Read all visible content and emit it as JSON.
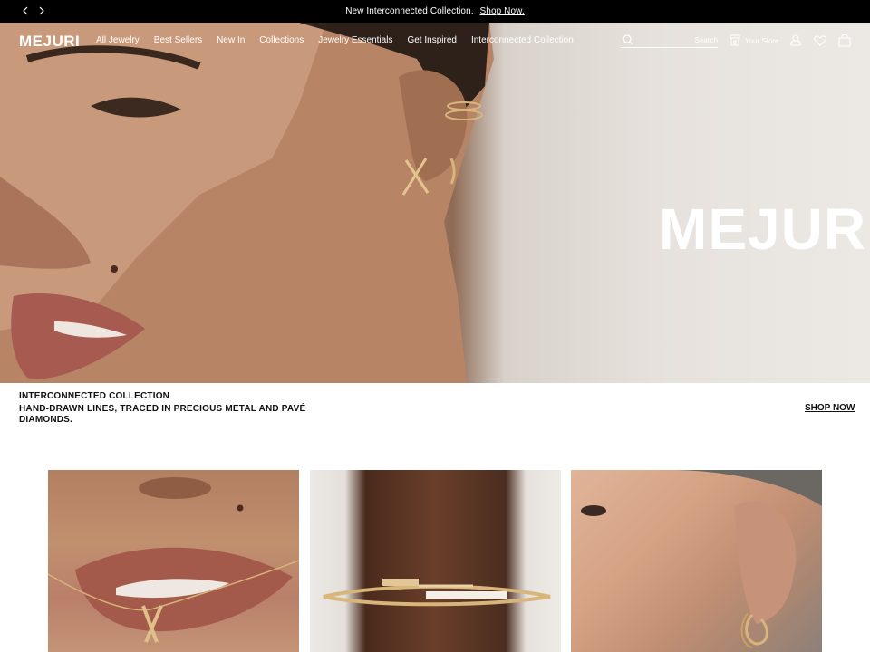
{
  "announcement": {
    "message": "New Interconnected Collection.",
    "link": "Shop Now."
  },
  "header": {
    "logo": "MEJURI",
    "menu": [
      "All Jewelry",
      "Best Sellers",
      "New In",
      "Collections",
      "Jewelry Essentials",
      "Get Inspired",
      "Interconnected Collection"
    ],
    "search_label": "Search",
    "store_label": "Your Store",
    "icons": [
      "search-icon",
      "store-icon",
      "account-icon",
      "wishlist-icon",
      "bag-icon"
    ]
  },
  "hero": {
    "brand_text": "MEJURI"
  },
  "caption": {
    "title": "INTERCONNECTED COLLECTION",
    "subtitle": "HAND-DRAWN LINES, TRACED IN PRECIOUS METAL AND PAVÉ DIAMONDS.",
    "cta": "SHOP NOW"
  },
  "colors": {
    "bar": "#000000",
    "text": "#111111",
    "white": "#ffffff"
  }
}
